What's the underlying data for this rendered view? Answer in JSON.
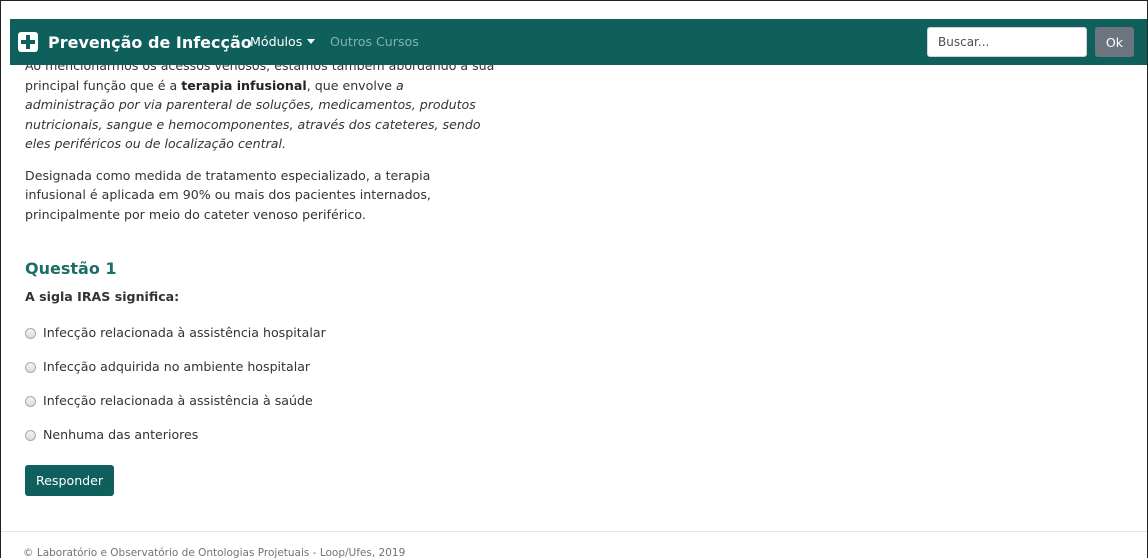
{
  "navbar": {
    "brand": "Prevenção de Infecção",
    "modulos": "Módulos",
    "outros_cursos": "Outros Cursos",
    "search_placeholder": "Buscar...",
    "ok_label": "Ok"
  },
  "content": {
    "p1_partial_line": "Ao mencionarmos os acessos venosos, estamos também abordando a sua",
    "p1_a": "principal função que é a ",
    "p1_bold": "terapia infusional",
    "p1_b": ", que envolve ",
    "p1_italic": "a administração por via parenteral de soluções, medicamentos, produtos nutricionais, sangue e hemocomponentes, através dos cateteres, sendo eles periféricos ou de localização central.",
    "p2": "Designada como medida de tratamento especializado, a terapia infusional é aplicada em 90% ou mais dos pacientes internados, principalmente por meio do cateter venoso periférico."
  },
  "question": {
    "title": "Questão 1",
    "text": "A sigla IRAS significa:",
    "options": [
      "Infecção relacionada à assistência hospitalar",
      "Infecção adquirida no ambiente hospitalar",
      "Infecção relacionada à assistência à saúde",
      "Nenhuma das anteriores"
    ],
    "submit_label": "Responder"
  },
  "footer": {
    "text": "© Laboratório e Observatório de Ontologias Projetuais - Loop/Ufes, 2019"
  },
  "colors": {
    "navbar_bg": "#0f5f5d",
    "accent_title": "#1d6c68",
    "button_bg": "#0f5f5d",
    "ok_bg": "#6c757d"
  }
}
